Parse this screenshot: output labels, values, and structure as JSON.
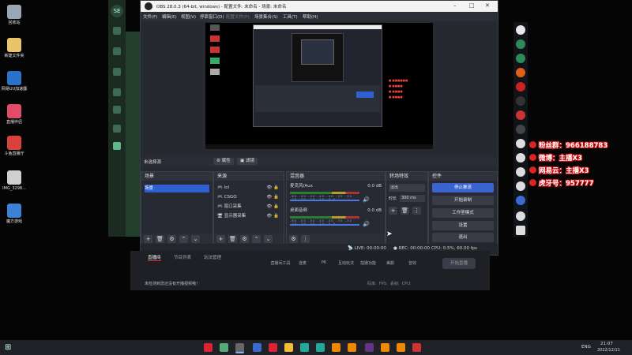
{
  "desktop": {
    "icons": [
      {
        "label": "回收站",
        "color": "#9aa7b4"
      },
      {
        "label": "新建文件夹",
        "color": "#e9c46a"
      },
      {
        "label": "网易UU加速器",
        "color": "#2a72c9"
      },
      {
        "label": "直播伴侣",
        "color": "#e34b6b"
      },
      {
        "label": "斗鱼直播厅",
        "color": "#d9423a"
      },
      {
        "label": "IMG_3298...",
        "color": "#d0d0d0"
      },
      {
        "label": "魔方游戏",
        "color": "#3b82d6"
      }
    ]
  },
  "app_left_sidebar": {
    "badge": "SE"
  },
  "obs": {
    "title": "OBS 28.0.3 (64-bit, windows) - 配置文件: 未命名 - 场景: 未命名",
    "menu": [
      "文件(F)",
      "编辑(E)",
      "视图(V)",
      "停靠窗口(D)",
      "配置文件(P)",
      "场景集合(S)",
      "工具(T)",
      "帮助(H)"
    ],
    "no_source_selected": "未选择源",
    "properties_button": "属性",
    "filters_button": "滤镜",
    "docks": {
      "scenes": {
        "title": "场景",
        "items": [
          "场景"
        ]
      },
      "sources": {
        "title": "来源",
        "items": [
          "lol",
          "CSGO",
          "窗口采集",
          "显示器采集"
        ]
      },
      "mixer": {
        "title": "混音器",
        "channels": [
          {
            "name": "麦克风/Aux",
            "db": "0.0 dB"
          },
          {
            "name": "桌面音频",
            "db": "0.0 dB"
          }
        ],
        "ticks": "-60 -55 -50 -45 -40 -35 -30 -25 -20 -15 -10 -5 0"
      },
      "transitions": {
        "title": "转场特效",
        "type": "淡出",
        "duration_label": "时长",
        "duration_value": "300 ms"
      },
      "controls": {
        "title": "控件",
        "buttons": [
          "停止推流",
          "开始录制",
          "工作室模式",
          "设置",
          "退出"
        ]
      }
    },
    "status": {
      "live": "LIVE: 00:00:00",
      "rec": "REC: 00:00:00",
      "cpu": "CPU: 0.5%, 60.00 fps"
    }
  },
  "stream_panel": {
    "tabs": [
      "直播间",
      "节目列表",
      "玩法管理"
    ],
    "actions": [
      "直播间工具",
      "连麦",
      "PK",
      "互动玩法",
      "拍摄功能",
      "美颜",
      "音效"
    ],
    "start_button": "开始直播",
    "notice": "未检测到您还没有开播视频哦！",
    "stats": [
      "码率:",
      "FPS:",
      "丢帧:",
      "CPU:"
    ]
  },
  "overlay": {
    "lines": [
      "粉丝群：966188783",
      "微博：主播X3",
      "网易云：主播X3",
      "虎牙号：957777"
    ]
  },
  "taskbar": {
    "lang": "ENG",
    "time": "21:07",
    "date": "2022/12/11"
  },
  "colors": {
    "accent": "#2f5fd0",
    "obs_bg": "#262930",
    "overlay_stroke": "#dd1111"
  }
}
